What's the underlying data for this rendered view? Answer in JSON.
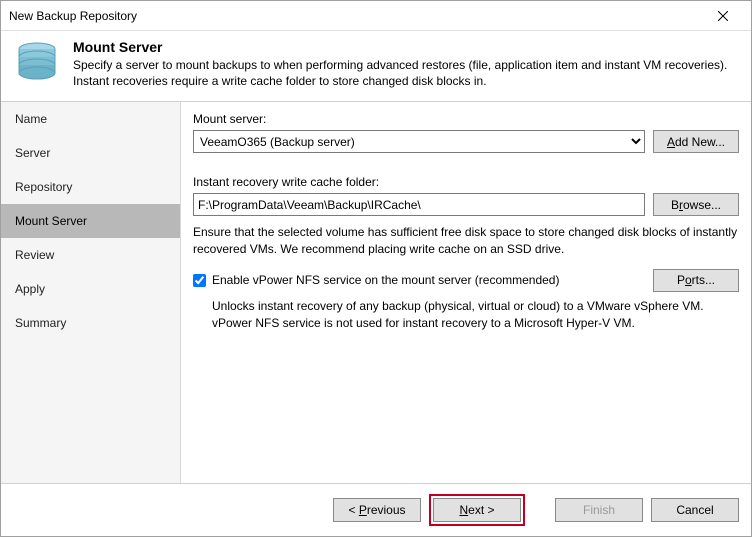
{
  "window": {
    "title": "New Backup Repository"
  },
  "header": {
    "title": "Mount Server",
    "description": "Specify a server to mount backups to when performing advanced restores (file, application item and instant VM recoveries). Instant recoveries require a write cache folder to store changed disk blocks in."
  },
  "sidebar": {
    "items": [
      {
        "label": "Name"
      },
      {
        "label": "Server"
      },
      {
        "label": "Repository"
      },
      {
        "label": "Mount Server"
      },
      {
        "label": "Review"
      },
      {
        "label": "Apply"
      },
      {
        "label": "Summary"
      }
    ],
    "active_index": 3
  },
  "main": {
    "mount_server_label": "Mount server:",
    "mount_server_value": "VeeamO365 (Backup server)",
    "add_new_label": "Add New...",
    "cache_label": "Instant recovery write cache folder:",
    "cache_value": "F:\\ProgramData\\Veeam\\Backup\\IRCache\\",
    "browse_label": "Browse...",
    "cache_help": "Ensure that the selected volume has sufficient free disk space to store changed disk blocks of instantly recovered VMs. We recommend placing write cache on an SSD drive.",
    "nfs_checked": true,
    "nfs_label": "Enable vPower NFS service on the mount server (recommended)",
    "ports_label": "Ports...",
    "nfs_help": "Unlocks instant recovery of any backup (physical, virtual or cloud) to a VMware vSphere VM. vPower NFS service is not used for instant recovery to a Microsoft Hyper-V VM."
  },
  "footer": {
    "previous": "< Previous",
    "next": "Next >",
    "finish": "Finish",
    "cancel": "Cancel"
  }
}
